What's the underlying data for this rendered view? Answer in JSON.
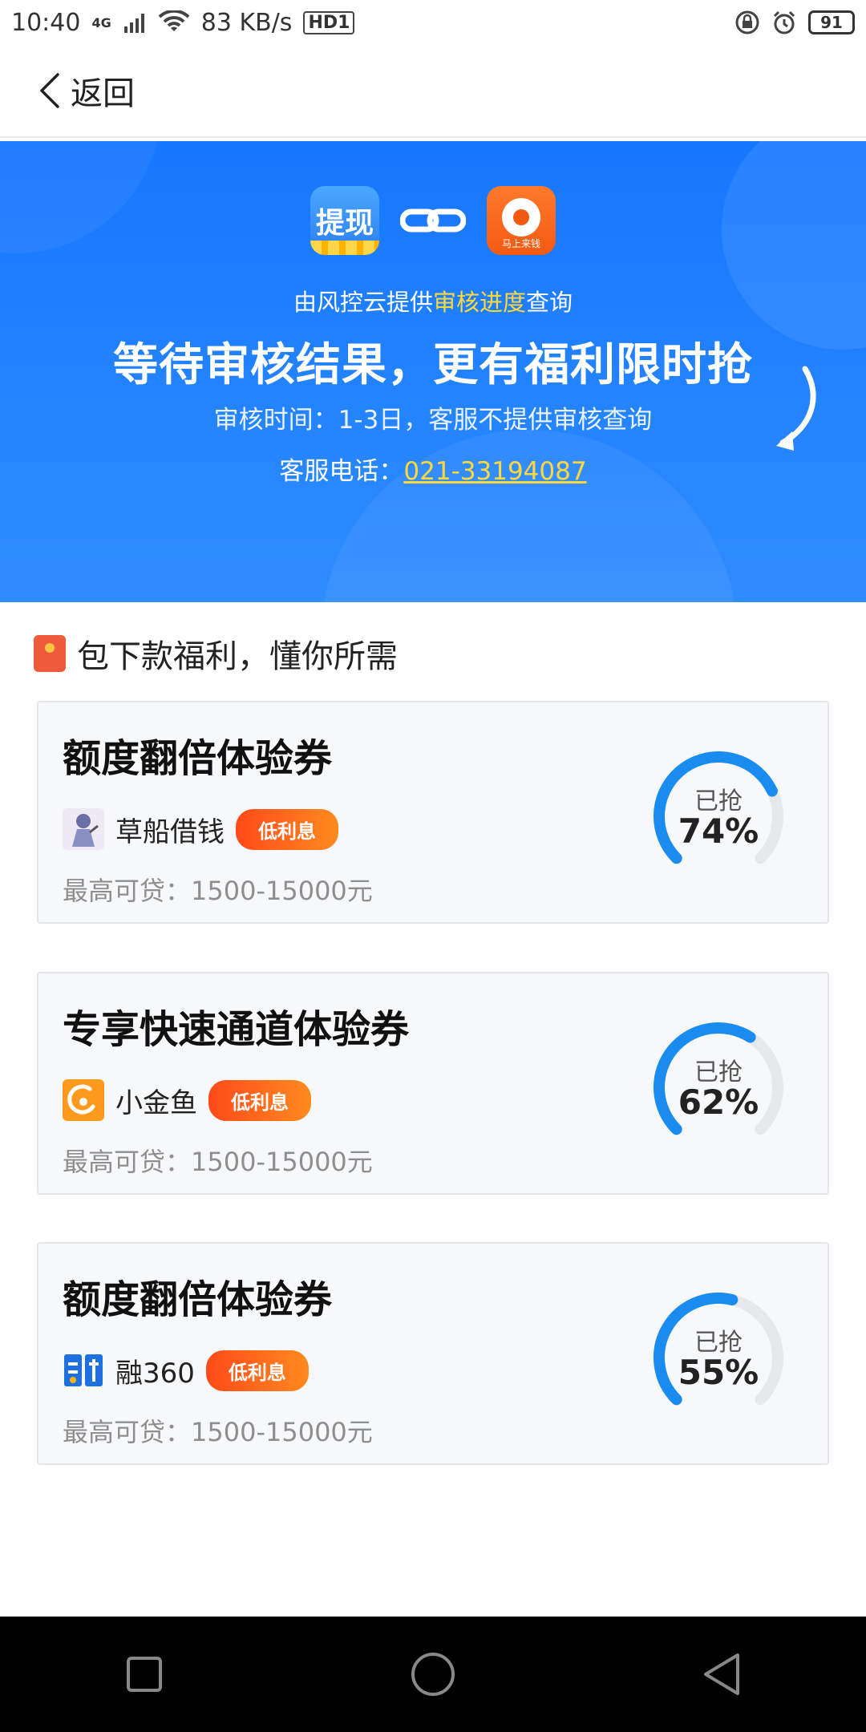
{
  "status_bar": {
    "time": "10:40",
    "network": "4G",
    "speed": "83 KB/s",
    "hd": "HD1",
    "battery": "91"
  },
  "nav": {
    "back_label": "返回"
  },
  "hero": {
    "logo_left_text": "提现",
    "logo_right_caption": "马上来钱",
    "line1_prefix": "由风控云提供",
    "line1_highlight": "审核进度",
    "line1_suffix": "查询",
    "title": "等待审核结果，更有福利限时抢",
    "review_time": "审核时间：1-3日，客服不提供审核查询",
    "phone_label": "客服电话：",
    "phone_number": "021-33194087"
  },
  "section": {
    "title": "包下款福利，懂你所需"
  },
  "cards": [
    {
      "title": "额度翻倍体验券",
      "vendor": "草船借钱",
      "tag": "低利息",
      "max_loan": "最高可贷：1500-15000元",
      "grabbed_label": "已抢",
      "grabbed_pct": "74%",
      "progress": 0.74
    },
    {
      "title": "专享快速通道体验券",
      "vendor": "小金鱼",
      "tag": "低利息",
      "max_loan": "最高可贷：1500-15000元",
      "grabbed_label": "已抢",
      "grabbed_pct": "62%",
      "progress": 0.62
    },
    {
      "title": "额度翻倍体验券",
      "vendor": "融360",
      "tag": "低利息",
      "max_loan": "最高可贷：1500-15000元",
      "grabbed_label": "已抢",
      "grabbed_pct": "55%",
      "progress": 0.55
    }
  ],
  "colors": {
    "primary_blue": "#1677ff",
    "highlight_yellow": "#ffd93b",
    "tag_orange": "#ff5a1a",
    "ring_track": "#e6e8ec",
    "ring_fill": "#1a8cf0"
  }
}
